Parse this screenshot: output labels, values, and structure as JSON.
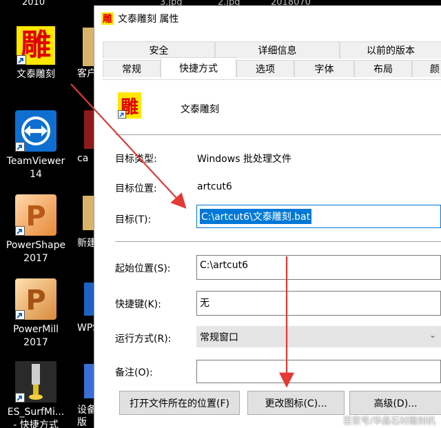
{
  "desktop": {
    "top_labels": [
      "2010",
      "3.jpg",
      "2.jpg",
      "2018070"
    ],
    "icons": [
      {
        "label": "文泰雕刻",
        "glyph": "雕"
      },
      {
        "label": "TeamViewer\n14"
      },
      {
        "label": "PowerShape\n2017"
      },
      {
        "label": "PowerMill\n2017"
      },
      {
        "label": "ES_SurfMi...\n- 快捷方式"
      }
    ],
    "col2_labels": [
      "客户",
      "ca",
      "新建",
      "WPS",
      "设备\n版"
    ]
  },
  "dialog": {
    "title": "文泰雕刻 属性",
    "tabs_row1": [
      "安全",
      "详细信息",
      "以前的版本"
    ],
    "tabs_row2": [
      "常规",
      "快捷方式",
      "选项",
      "字体",
      "布局",
      "颜"
    ],
    "active_tab": "快捷方式",
    "shortcut_name": "文泰雕刻",
    "icon_glyph": "雕",
    "target_type_label": "目标类型:",
    "target_type_value": "Windows 批处理文件",
    "target_location_label": "目标位置:",
    "target_location_value": "artcut6",
    "target_label": "目标(T):",
    "target_value": "C:\\artcut6\\文泰雕刻.bat",
    "start_in_label": "起始位置(S):",
    "start_in_value": "C:\\artcut6",
    "hotkey_label": "快捷键(K):",
    "hotkey_value": "无",
    "run_label": "运行方式(R):",
    "run_value": "常规窗口",
    "comment_label": "备注(O):",
    "comment_value": "",
    "buttons": {
      "open_location": "打开文件所在的位置(F)",
      "change_icon": "更改图标(C)...",
      "advanced": "高级(D)..."
    }
  },
  "watermark": "百家号/华鑫石材雕刻机",
  "colors": {
    "accent": "#0078d7",
    "arrow": "#e53935",
    "icon_bg": "#ffe800",
    "icon_glyph": "#e00000"
  }
}
